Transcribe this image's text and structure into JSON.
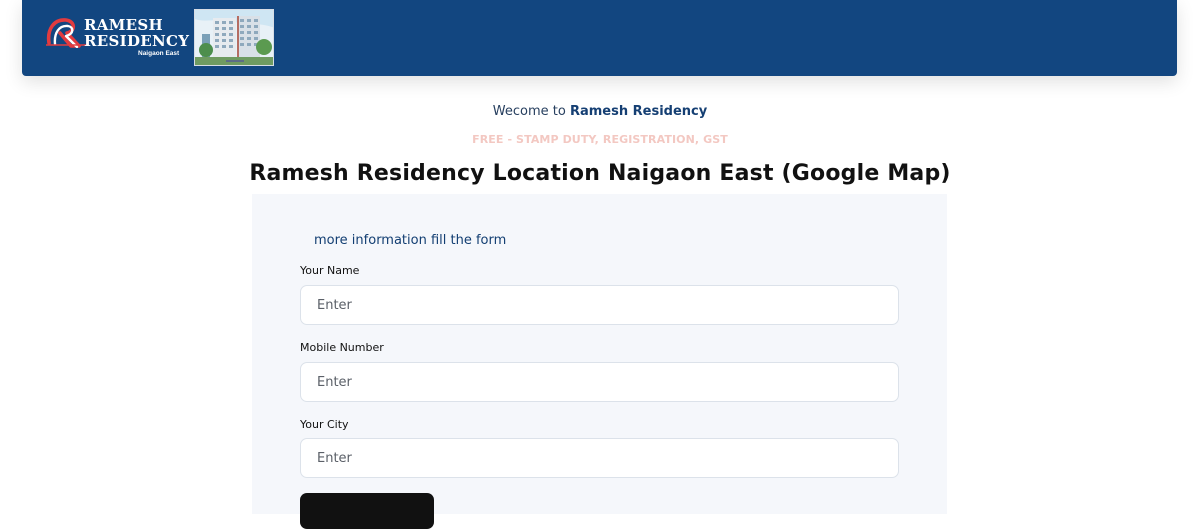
{
  "header": {
    "brand_line1": "RAMESH",
    "brand_line2": "RESIDENCY",
    "brand_sub": "Naigaon East",
    "logo_icon": "rr-monogram-icon",
    "thumbnail_icon": "building-photo-icon",
    "background_color": "#124680"
  },
  "intro": {
    "welcome_prefix": "Wecome to",
    "welcome_name": "Ramesh Residency",
    "offer_text": "FREE - STAMP DUTY, REGISTRATION, GST",
    "heading": "Ramesh Residency Location Naigaon East (Google Map)"
  },
  "form": {
    "intro_text": "more information fill the form",
    "fields": [
      {
        "label": "Your Name",
        "placeholder": "Enter",
        "value": ""
      },
      {
        "label": "Mobile Number",
        "placeholder": "Enter",
        "value": ""
      },
      {
        "label": "Your City",
        "placeholder": "Enter",
        "value": ""
      }
    ],
    "submit_label": "",
    "button_color": "#111111"
  }
}
